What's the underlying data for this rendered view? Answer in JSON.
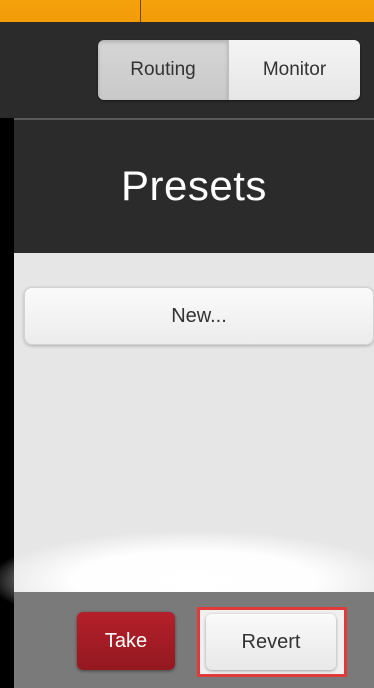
{
  "tabs": {
    "routing_label": "Routing",
    "monitor_label": "Monitor",
    "active": "Routing"
  },
  "panel": {
    "title": "Presets",
    "new_button_label": "New..."
  },
  "footer": {
    "take_label": "Take",
    "revert_label": "Revert"
  },
  "colors": {
    "accent": "#f29d08",
    "header_bg": "#2b2b2b",
    "take_red": "#a51c24",
    "highlight_border": "#e03a3a"
  }
}
